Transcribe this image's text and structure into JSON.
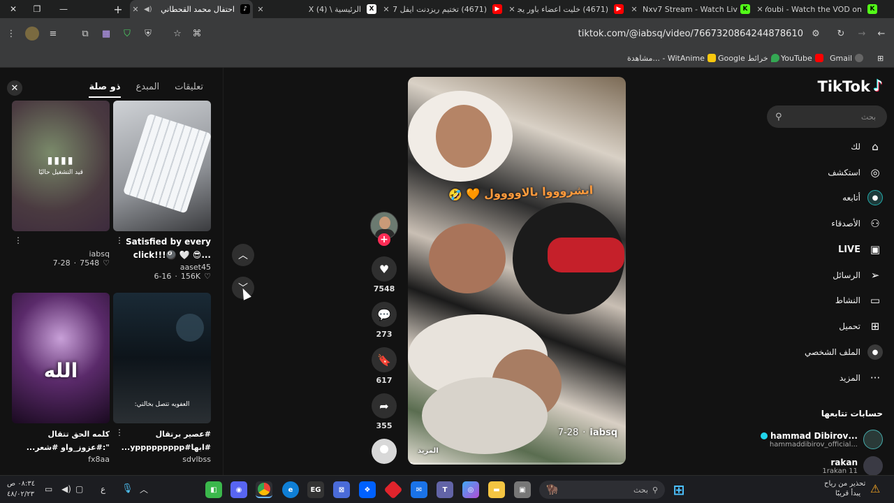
{
  "tabs": [
    {
      "title": "Youbi - Watch the VOD on",
      "fav": "K",
      "color": "#53fc18"
    },
    {
      "title": "Nxv7 Stream - Watch Live",
      "fav": "K",
      "color": "#53fc18"
    },
    {
      "title": "(4671) خليت اعضاء باور يجر",
      "fav": "▶",
      "color": "#ff0000"
    },
    {
      "title": "(4671) تختيم ريزدنت ايفل 7",
      "fav": "▶",
      "color": "#ff0000"
    },
    {
      "title": "الرئيسية \\ X (4)",
      "fav": "X",
      "color": "#000000"
    },
    {
      "title": "احتفال محمد القحطاني",
      "fav": "♪",
      "color": "#000000"
    }
  ],
  "address": {
    "url": "tiktok.com/@iabsq/video/7667320864244878610"
  },
  "bookmarks": [
    {
      "label": "Gmail",
      "color": "#ea4335"
    },
    {
      "label": "YouTube",
      "color": "#ff0000"
    },
    {
      "label": "Google خرائط",
      "color": "#34a853"
    },
    {
      "label": "مشاهدة... - WitAnime",
      "color": "#f9c80e"
    }
  ],
  "nav": {
    "logo": "TikTok",
    "search_placeholder": "بحث",
    "items": [
      {
        "label": "لك",
        "icon": "⌂"
      },
      {
        "label": "استكشف",
        "icon": "◎"
      },
      {
        "label": "أتابعه",
        "icon": "●"
      },
      {
        "label": "الأصدقاء",
        "icon": "👥"
      },
      {
        "label": "LIVE",
        "icon": "📺"
      },
      {
        "label": "الرسائل",
        "icon": "➤"
      },
      {
        "label": "النشاط",
        "icon": "▭"
      },
      {
        "label": "تحميل",
        "icon": "⊞"
      },
      {
        "label": "الملف الشخصي",
        "icon": "●"
      },
      {
        "label": "المزيد",
        "icon": "···"
      }
    ],
    "following_title": "حسابات تتابعها",
    "accounts": [
      {
        "name": "...hammad Dibirov",
        "handle": "...hammaddibirov_official",
        "verified": true
      },
      {
        "name": "rakan",
        "handle": "1rakan 11",
        "verified": false
      }
    ]
  },
  "video": {
    "caption": "ابشروووا بالاوووول 🧡 🤣",
    "username": "iabsq",
    "date": "7-28",
    "more": "المزيد",
    "progress": 0.02
  },
  "actions": {
    "likes": "7548",
    "comments": "273",
    "saves": "617",
    "shares": "355"
  },
  "panel": {
    "tabs": [
      "تعليقات",
      "المبدع",
      "ذو صلة"
    ],
    "active_tab": 2,
    "videos": [
      {
        "desc": "Satisfied by every click!!!🎱 🤍 😎...",
        "author": "aaset45",
        "likes": "156K",
        "date": "6-16",
        "overlay": ""
      },
      {
        "desc": "",
        "author": "iabsq",
        "likes": "7548",
        "date": "7-28",
        "overlay": "قيد التشغيل حاليًا"
      },
      {
        "desc": "#عصير برتقال #ابها#yppppppppp...",
        "author": "sdvlbss",
        "likes": "",
        "date": "",
        "overlay": "العفويه تتصل بخالتي:"
      },
      {
        "desc": "كلمه الحق تتقال \":#عزوز_واو #شعر...",
        "author": "fx8aa",
        "likes": "",
        "date": "",
        "overlay": "الله"
      }
    ]
  },
  "taskbar": {
    "search_placeholder": "بحث",
    "weather_line1": "تحذير من رياح",
    "weather_line2": "يبدأ قريبًا",
    "time": "٠٨:٣٤ ص",
    "date": "٤٨/٠٢/٢٣",
    "lang": "ع"
  }
}
